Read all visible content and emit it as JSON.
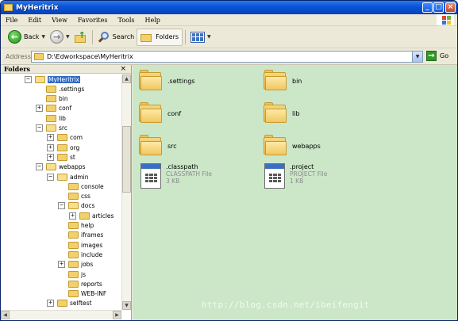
{
  "window": {
    "title": "MyHeritrix"
  },
  "menu": [
    "File",
    "Edit",
    "View",
    "Favorites",
    "Tools",
    "Help"
  ],
  "toolbar": {
    "back_label": "Back",
    "search_label": "Search",
    "folders_label": "Folders"
  },
  "address": {
    "label": "Address",
    "value": "D:\\Edworkspace\\MyHeritrix",
    "go_label": "Go"
  },
  "folders_pane": {
    "title": "Folders",
    "close_glyph": "×",
    "tree": [
      {
        "label": "MyHeritrix",
        "level": 0,
        "expander": "−",
        "selected": true,
        "open": true
      },
      {
        "label": ".settings",
        "level": 1,
        "expander": ""
      },
      {
        "label": "bin",
        "level": 1,
        "expander": ""
      },
      {
        "label": "conf",
        "level": 1,
        "expander": "+"
      },
      {
        "label": "lib",
        "level": 1,
        "expander": ""
      },
      {
        "label": "src",
        "level": 1,
        "expander": "−",
        "open": true
      },
      {
        "label": "com",
        "level": 2,
        "expander": "+"
      },
      {
        "label": "org",
        "level": 2,
        "expander": "+"
      },
      {
        "label": "st",
        "level": 2,
        "expander": "+"
      },
      {
        "label": "webapps",
        "level": 1,
        "expander": "−",
        "open": true
      },
      {
        "label": "admin",
        "level": 2,
        "expander": "−",
        "open": true
      },
      {
        "label": "console",
        "level": 3,
        "expander": ""
      },
      {
        "label": "css",
        "level": 3,
        "expander": ""
      },
      {
        "label": "docs",
        "level": 3,
        "expander": "−",
        "open": true
      },
      {
        "label": "articles",
        "level": 4,
        "expander": "+"
      },
      {
        "label": "help",
        "level": 3,
        "expander": ""
      },
      {
        "label": "iframes",
        "level": 3,
        "expander": ""
      },
      {
        "label": "images",
        "level": 3,
        "expander": ""
      },
      {
        "label": "include",
        "level": 3,
        "expander": ""
      },
      {
        "label": "jobs",
        "level": 3,
        "expander": "+"
      },
      {
        "label": "js",
        "level": 3,
        "expander": ""
      },
      {
        "label": "reports",
        "level": 3,
        "expander": ""
      },
      {
        "label": "WEB-INF",
        "level": 3,
        "expander": ""
      },
      {
        "label": "selftest",
        "level": 2,
        "expander": "+"
      }
    ]
  },
  "content": {
    "folders": [
      ".settings",
      "bin",
      "conf",
      "lib",
      "src",
      "webapps"
    ],
    "files": [
      {
        "name": ".classpath",
        "type": "CLASSPATH File",
        "size": "3 KB"
      },
      {
        "name": ".project",
        "type": "PROJECT File",
        "size": "1 KB"
      }
    ]
  },
  "watermark": "http://blog.csdn.net/ibeifengit",
  "colors": {
    "content_bg": "#cbe7c8",
    "titlebar": "#0a56d8",
    "selection": "#316ac5"
  }
}
